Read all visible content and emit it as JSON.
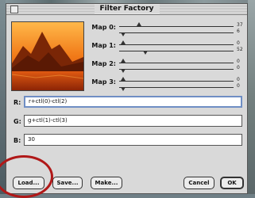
{
  "window": {
    "title": "Filter Factory"
  },
  "maps": [
    {
      "label": "Map 0:",
      "values": [
        "37",
        "6"
      ]
    },
    {
      "label": "Map 1:",
      "values": [
        "0",
        "52"
      ]
    },
    {
      "label": "Map 2:",
      "values": [
        "0",
        "0"
      ]
    },
    {
      "label": "Map 3:",
      "values": [
        "0",
        "0"
      ]
    }
  ],
  "expressions": [
    {
      "label": "R:",
      "value": "r+ctl(0)-ctl(2)"
    },
    {
      "label": "G:",
      "value": "g+ctl(1)-ctl(3)"
    },
    {
      "label": "B:",
      "value": "30"
    }
  ],
  "buttons": {
    "load": "Load...",
    "save": "Save...",
    "make": "Make...",
    "cancel": "Cancel",
    "ok": "OK"
  },
  "annotation": {
    "color": "#b01818"
  }
}
